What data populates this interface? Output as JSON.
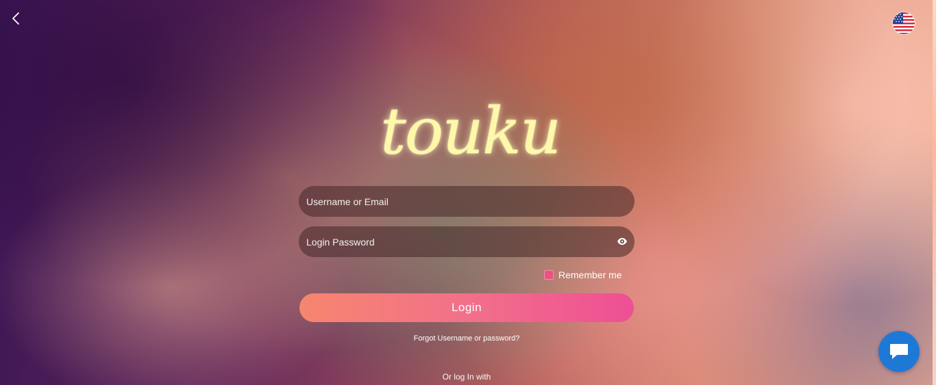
{
  "nav": {
    "back_icon": "chevron-left-icon",
    "language_flag_icon": "us-flag-icon"
  },
  "brand": {
    "logo_text": "touku"
  },
  "form": {
    "username_placeholder": "Username or Email",
    "password_placeholder": "Login Password",
    "password_toggle_icon": "eye-icon",
    "remember_label": "Remember me",
    "remember_checked": true,
    "login_label": "Login",
    "forgot_label": "Forgot Username or password?",
    "or_login_label": "Or log In with"
  },
  "chat": {
    "icon": "chat-bubble-icon"
  },
  "colors": {
    "login_gradient_start": "#f6866e",
    "login_gradient_end": "#ee4f94",
    "checkbox": "#e8547e",
    "chat_button": "#1e79d6",
    "logo": "#fff8a8"
  }
}
